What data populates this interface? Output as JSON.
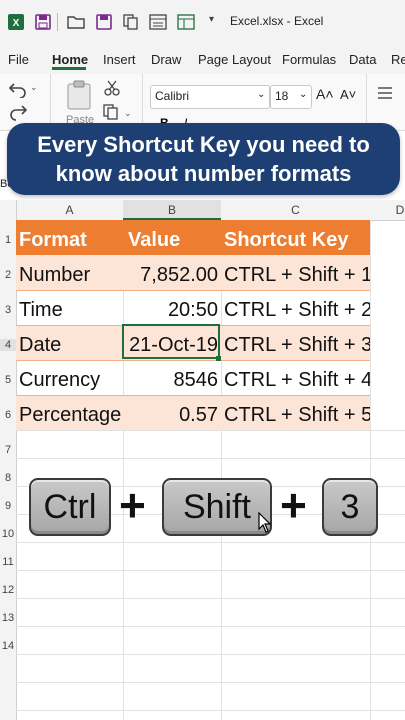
{
  "window": {
    "title": "Excel.xlsx  -  Excel"
  },
  "menu": [
    "File",
    "Home",
    "Insert",
    "Draw",
    "Page Layout",
    "Formulas",
    "Data",
    "Re"
  ],
  "ribbon": {
    "paste_label": "Paste",
    "font_name": "Calibri",
    "font_size": "18",
    "grow_font": "A˄",
    "shrink_font": "A˅",
    "bold": "B",
    "italic": "I"
  },
  "banner": {
    "line1": "Every Shortcut Key you need to",
    "line2": "know about number formats"
  },
  "name_box": "Bo",
  "columns": [
    "A",
    "B",
    "C",
    "D"
  ],
  "rows": [
    "1",
    "2",
    "3",
    "4",
    "5",
    "6",
    "7",
    "8",
    "9",
    "10",
    "11",
    "12",
    "13",
    "14"
  ],
  "table": {
    "headers": [
      "Format",
      "Value",
      "Shortcut Key"
    ],
    "rows": [
      [
        "Number",
        "7,852.00",
        "CTRL + Shift + 1"
      ],
      [
        "Time",
        "20:50",
        "CTRL + Shift + 2"
      ],
      [
        "Date",
        "21-Oct-19",
        "CTRL + Shift + 3"
      ],
      [
        "Currency",
        "8546",
        "CTRL + Shift + 4"
      ],
      [
        "Percentage",
        "0.57",
        "CTRL + Shift + 5"
      ]
    ]
  },
  "keys": {
    "k1": "Ctrl",
    "plus": "+",
    "k2": "Shift",
    "k3": "3"
  },
  "colors": {
    "accent": "#ed7d31",
    "light_row": "#fce4d6",
    "banner": "#1e3f73",
    "excel_green": "#1e6e3e"
  }
}
